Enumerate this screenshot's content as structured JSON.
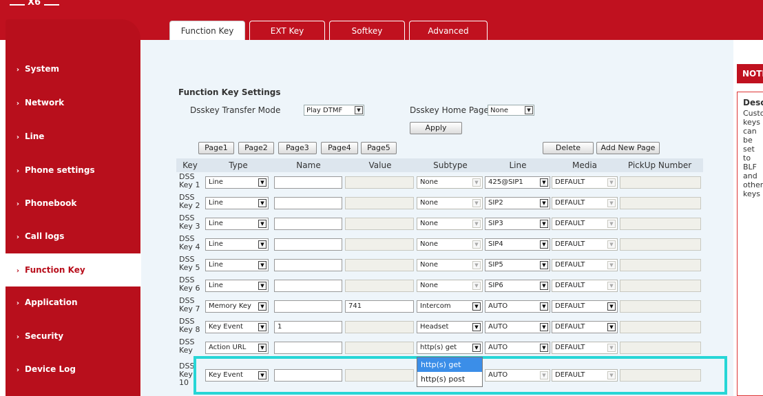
{
  "header": {
    "logo": "X6"
  },
  "sidebar": {
    "items": [
      {
        "label": "System"
      },
      {
        "label": "Network"
      },
      {
        "label": "Line"
      },
      {
        "label": "Phone settings"
      },
      {
        "label": "Phonebook"
      },
      {
        "label": "Call logs"
      },
      {
        "label": "Function Key",
        "active": true
      },
      {
        "label": "Application"
      },
      {
        "label": "Security"
      },
      {
        "label": "Device Log"
      }
    ]
  },
  "tabs": [
    "Function Key",
    "EXT Key",
    "Softkey",
    "Advanced"
  ],
  "active_tab": "Function Key",
  "settings": {
    "title": "Function Key Settings",
    "transfer_mode_label": "Dsskey Transfer Mode",
    "transfer_mode_value": "Play DTMF",
    "home_page_label": "Dsskey Home Page:",
    "home_page_value": "None",
    "apply": "Apply"
  },
  "pages": [
    "Page1",
    "Page2",
    "Page3",
    "Page4",
    "Page5"
  ],
  "actions": {
    "delete": "Delete",
    "add_page": "Add New Page"
  },
  "table": {
    "headers": [
      "Key",
      "Type",
      "Name",
      "Value",
      "Subtype",
      "Line",
      "Media",
      "PickUp Number"
    ],
    "rows": [
      {
        "key1": "DSS",
        "key2": "Key 1",
        "type": "Line",
        "name": "",
        "value": "",
        "subtype": "None",
        "line": "425@SIP1",
        "media": "DEFAULT",
        "pickup": ""
      },
      {
        "key1": "DSS",
        "key2": "Key 2",
        "type": "Line",
        "name": "",
        "value": "",
        "subtype": "None",
        "line": "SIP2",
        "media": "DEFAULT",
        "pickup": ""
      },
      {
        "key1": "DSS",
        "key2": "Key 3",
        "type": "Line",
        "name": "",
        "value": "",
        "subtype": "None",
        "line": "SIP3",
        "media": "DEFAULT",
        "pickup": ""
      },
      {
        "key1": "DSS",
        "key2": "Key 4",
        "type": "Line",
        "name": "",
        "value": "",
        "subtype": "None",
        "line": "SIP4",
        "media": "DEFAULT",
        "pickup": ""
      },
      {
        "key1": "DSS",
        "key2": "Key 5",
        "type": "Line",
        "name": "",
        "value": "",
        "subtype": "None",
        "line": "SIP5",
        "media": "DEFAULT",
        "pickup": ""
      },
      {
        "key1": "DSS",
        "key2": "Key 6",
        "type": "Line",
        "name": "",
        "value": "",
        "subtype": "None",
        "line": "SIP6",
        "media": "DEFAULT",
        "pickup": ""
      },
      {
        "key1": "DSS",
        "key2": "Key 7",
        "type": "Memory Key",
        "name": "",
        "value": "741",
        "subtype": "Intercom",
        "line": "AUTO",
        "media": "DEFAULT",
        "pickup": ""
      },
      {
        "key1": "DSS",
        "key2": "Key 8",
        "type": "Key Event",
        "name": "1",
        "value": "",
        "subtype": "Headset",
        "line": "AUTO",
        "media": "DEFAULT",
        "pickup": ""
      },
      {
        "key1": "DSS",
        "key2": "Key",
        "type": "Action URL",
        "name": "",
        "value": "",
        "subtype": "http(s) get",
        "line": "AUTO",
        "media": "DEFAULT",
        "pickup": ""
      },
      {
        "key1": "DSS",
        "key2": "Key",
        "key3": "10",
        "type": "Key Event",
        "name": "",
        "value": "",
        "subtype": "",
        "line": "AUTO",
        "media": "DEFAULT",
        "pickup": ""
      }
    ]
  },
  "dropdown": {
    "options": [
      "http(s) get",
      "http(s) post"
    ],
    "selected": "http(s) get"
  },
  "note": {
    "head": "NOTE",
    "title": "Description",
    "text": "Custom keys can be set to BLF and other keys"
  },
  "colors": {
    "brand_red": "#c0111f",
    "highlight": "#27d6d6",
    "selected_option": "#3b8ee8"
  }
}
